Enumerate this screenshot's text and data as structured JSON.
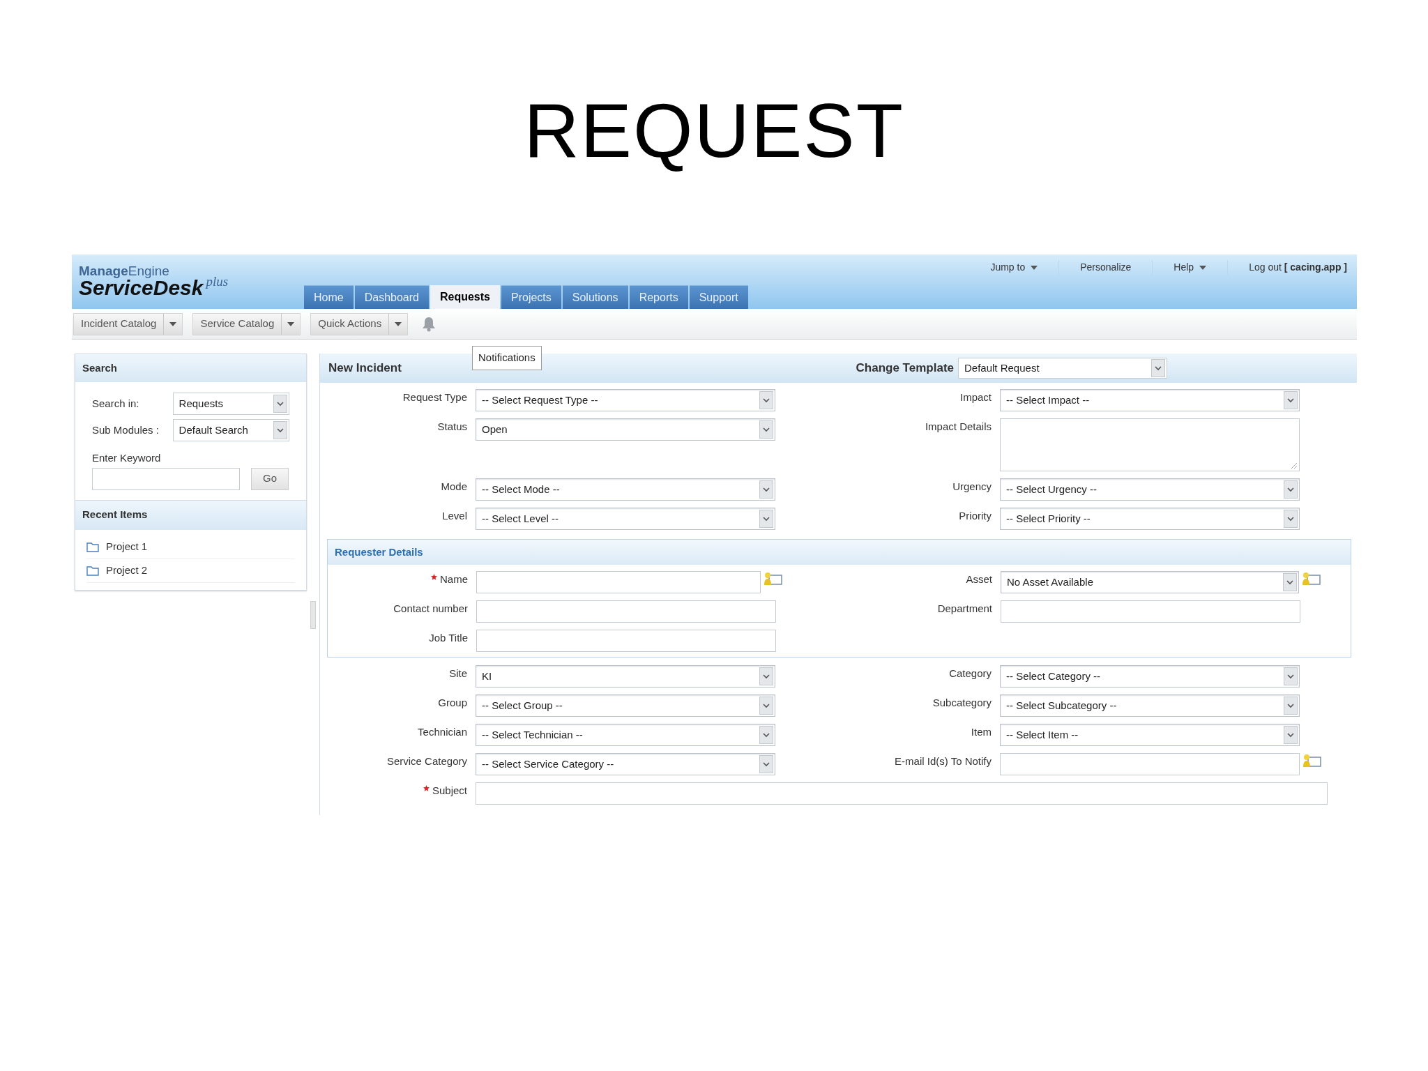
{
  "slide_title": "REQUEST",
  "logo": {
    "brand_bold": "Manage",
    "brand_light": "Engine",
    "product": "ServiceDesk",
    "edition": "plus"
  },
  "top_links": [
    {
      "label": "Jump to",
      "dropdown": true
    },
    {
      "label": "Personalize",
      "dropdown": false
    },
    {
      "label": "Help",
      "dropdown": true
    },
    {
      "label": "Log out **[ cacing.app ]**",
      "dropdown": false
    }
  ],
  "tabs": [
    {
      "label": "Home",
      "selected": false
    },
    {
      "label": "Dashboard",
      "selected": false
    },
    {
      "label": "Requests",
      "selected": true
    },
    {
      "label": "Projects",
      "selected": false
    },
    {
      "label": "Solutions",
      "selected": false
    },
    {
      "label": "Reports",
      "selected": false
    },
    {
      "label": "Support",
      "selected": false
    }
  ],
  "toolbar": {
    "menus": [
      "Incident Catalog",
      "Service Catalog",
      "Quick Actions"
    ],
    "tooltip": "Notifications"
  },
  "sidebar": {
    "search": {
      "title": "Search",
      "fields": [
        {
          "label": "Search in:",
          "value": "Requests"
        },
        {
          "label": "Sub Modules :",
          "value": "Default Search"
        }
      ],
      "keyword_label": "Enter Keyword",
      "go": "Go"
    },
    "recent": {
      "title": "Recent Items",
      "items": [
        "Project 1",
        "Project 2"
      ]
    }
  },
  "form": {
    "title": "New Incident",
    "template": {
      "label": "Change Template",
      "value": "Default Request"
    },
    "rows": [
      {
        "left": {
          "label": "Request Type",
          "kind": "select",
          "value": "-- Select Request Type --",
          "required": false,
          "lookup": false
        },
        "right": {
          "label": "Impact",
          "kind": "select",
          "value": "-- Select Impact --",
          "required": false,
          "lookup": false
        }
      },
      {
        "left": {
          "label": "Status",
          "kind": "select",
          "value": "Open",
          "required": false,
          "lookup": false
        },
        "right": {
          "label": "Impact Details",
          "kind": "textarea",
          "required": false,
          "lookup": false
        }
      },
      {
        "left": {
          "label": "Mode",
          "kind": "select",
          "value": "-- Select Mode --",
          "required": false,
          "lookup": false
        },
        "right": {
          "label": "Urgency",
          "kind": "select",
          "value": "-- Select Urgency --",
          "required": false,
          "lookup": false
        }
      },
      {
        "left": {
          "label": "Level",
          "kind": "select",
          "value": "-- Select Level --",
          "required": false,
          "lookup": false
        },
        "right": {
          "label": "Priority",
          "kind": "select",
          "value": "-- Select Priority --",
          "required": false,
          "lookup": false
        }
      }
    ],
    "requester": {
      "title": "Requester Details",
      "rows": [
        {
          "left": {
            "label": "Name",
            "kind": "text",
            "required": true,
            "lookup": true
          },
          "right": {
            "label": "Asset",
            "kind": "select",
            "value": "No Asset Available",
            "required": false,
            "lookup": true
          }
        },
        {
          "left": {
            "label": "Contact number",
            "kind": "text",
            "required": false,
            "lookup": false
          },
          "right": {
            "label": "Department",
            "kind": "text",
            "required": false,
            "lookup": false
          }
        },
        {
          "left": {
            "label": "Job Title",
            "kind": "text",
            "required": false,
            "lookup": false
          }
        }
      ]
    },
    "rows_after": [
      {
        "left": {
          "label": "Site",
          "kind": "select",
          "value": "KI",
          "required": false,
          "lookup": false
        },
        "right": {
          "label": "Category",
          "kind": "select",
          "value": "-- Select Category --",
          "required": false,
          "lookup": false
        }
      },
      {
        "left": {
          "label": "Group",
          "kind": "select",
          "value": "-- Select Group --",
          "required": false,
          "lookup": false
        },
        "right": {
          "label": "Subcategory",
          "kind": "select",
          "value": "-- Select Subcategory --",
          "required": false,
          "lookup": false
        }
      },
      {
        "left": {
          "label": "Technician",
          "kind": "select",
          "value": "-- Select Technician --",
          "required": false,
          "lookup": false
        },
        "right": {
          "label": "Item",
          "kind": "select",
          "value": "-- Select Item --",
          "required": false,
          "lookup": false
        }
      },
      {
        "left": {
          "label": "Service Category",
          "kind": "select",
          "value": "-- Select Service Category --",
          "required": false,
          "lookup": false
        },
        "right": {
          "label": "E-mail Id(s) To Notify",
          "kind": "text",
          "required": false,
          "lookup": true
        }
      },
      {
        "full": {
          "label": "Subject",
          "kind": "text",
          "required": true,
          "lookup": false
        }
      }
    ]
  }
}
